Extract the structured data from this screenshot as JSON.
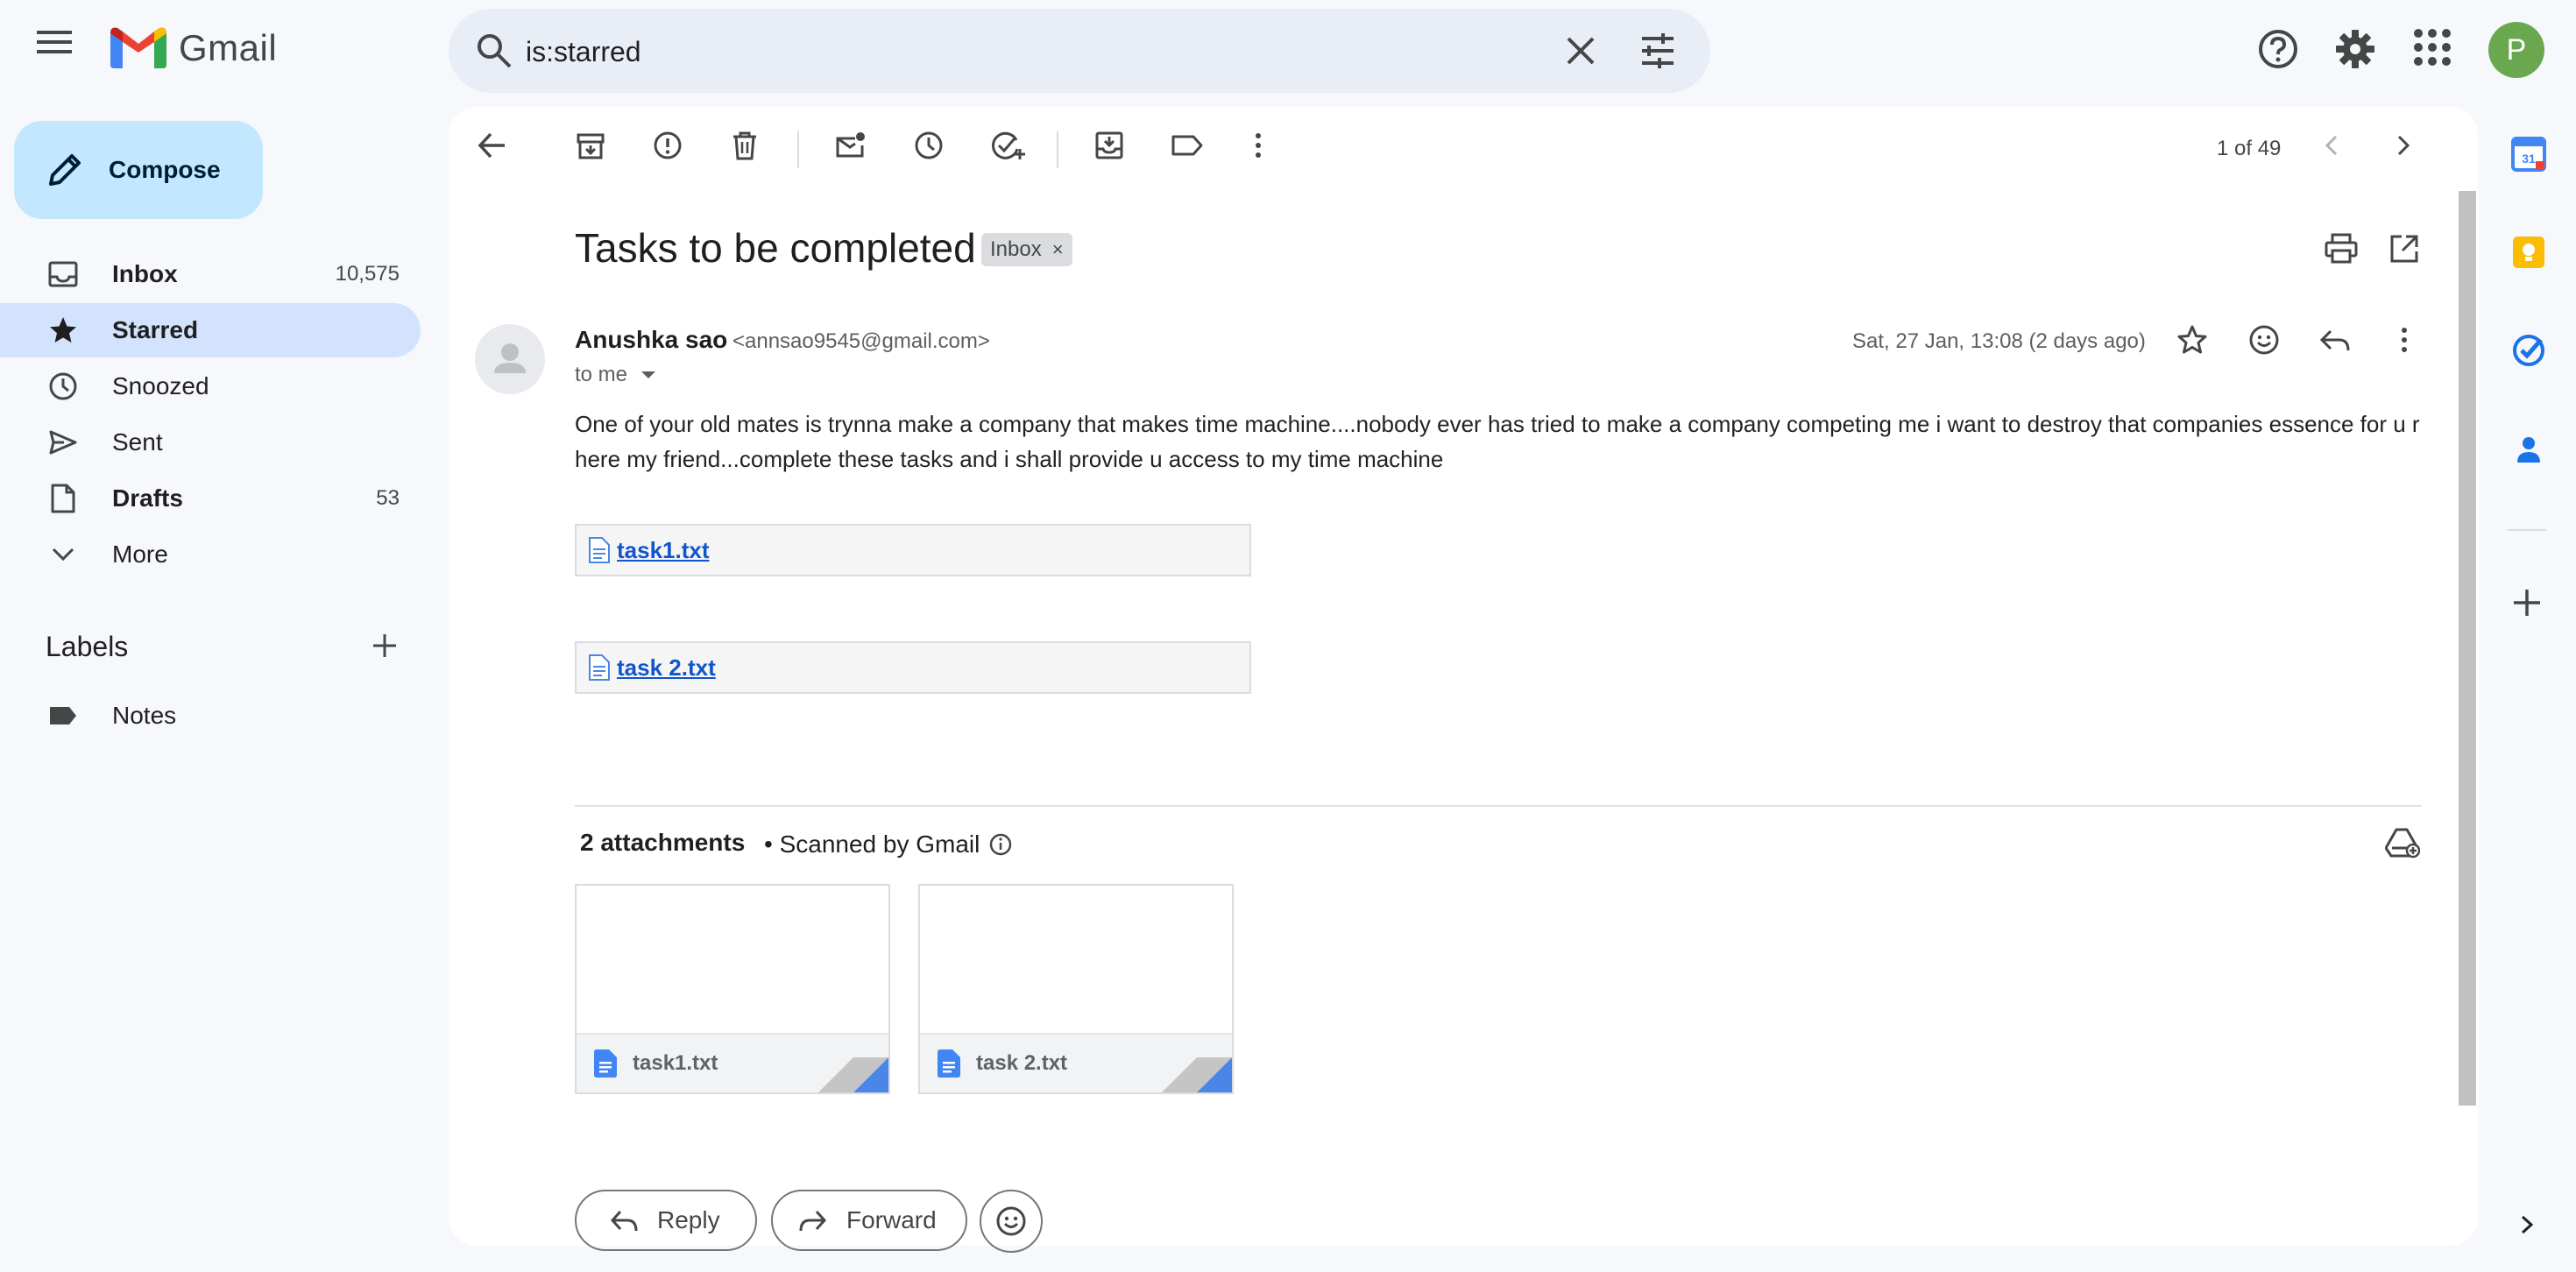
{
  "app": {
    "name": "Gmail"
  },
  "search": {
    "query": "is:starred"
  },
  "account": {
    "avatar_letter": "P"
  },
  "sidebar": {
    "compose_label": "Compose",
    "items": [
      {
        "label": "Inbox",
        "count": "10,575"
      },
      {
        "label": "Starred",
        "count": ""
      },
      {
        "label": "Snoozed",
        "count": ""
      },
      {
        "label": "Sent",
        "count": ""
      },
      {
        "label": "Drafts",
        "count": "53"
      },
      {
        "label": "More",
        "count": ""
      }
    ],
    "labels_title": "Labels",
    "labels": [
      {
        "label": "Notes"
      }
    ]
  },
  "toolbar": {
    "pager": "1 of 49"
  },
  "email": {
    "subject": "Tasks to be completed",
    "chip": "Inbox",
    "sender_name": "Anushka sao",
    "sender_email": "<annsao9545@gmail.com>",
    "to": "to me",
    "date": "Sat, 27 Jan, 13:08 (2 days ago)",
    "body_line1": "One of your old mates is trynna make a company that makes time machine....nobody ever has tried to make a company competing me i want to destroy that companies essence for u r",
    "body_line2": "here my friend...complete these tasks and i shall provide u access to my time machine",
    "inline_attachments": [
      "task1.txt",
      "task 2.txt"
    ]
  },
  "attachments": {
    "count_label": "2 attachments",
    "scanned_label": "• Scanned by Gmail",
    "files": [
      "task1.txt",
      "task 2.txt"
    ]
  },
  "actions": {
    "reply": "Reply",
    "forward": "Forward"
  },
  "colors": {
    "accent": "#0b57d0",
    "compose_bg": "#c2e7ff",
    "active_nav": "#d3e3fd",
    "link": "#1155cc",
    "avatar": "#6aa84f"
  }
}
